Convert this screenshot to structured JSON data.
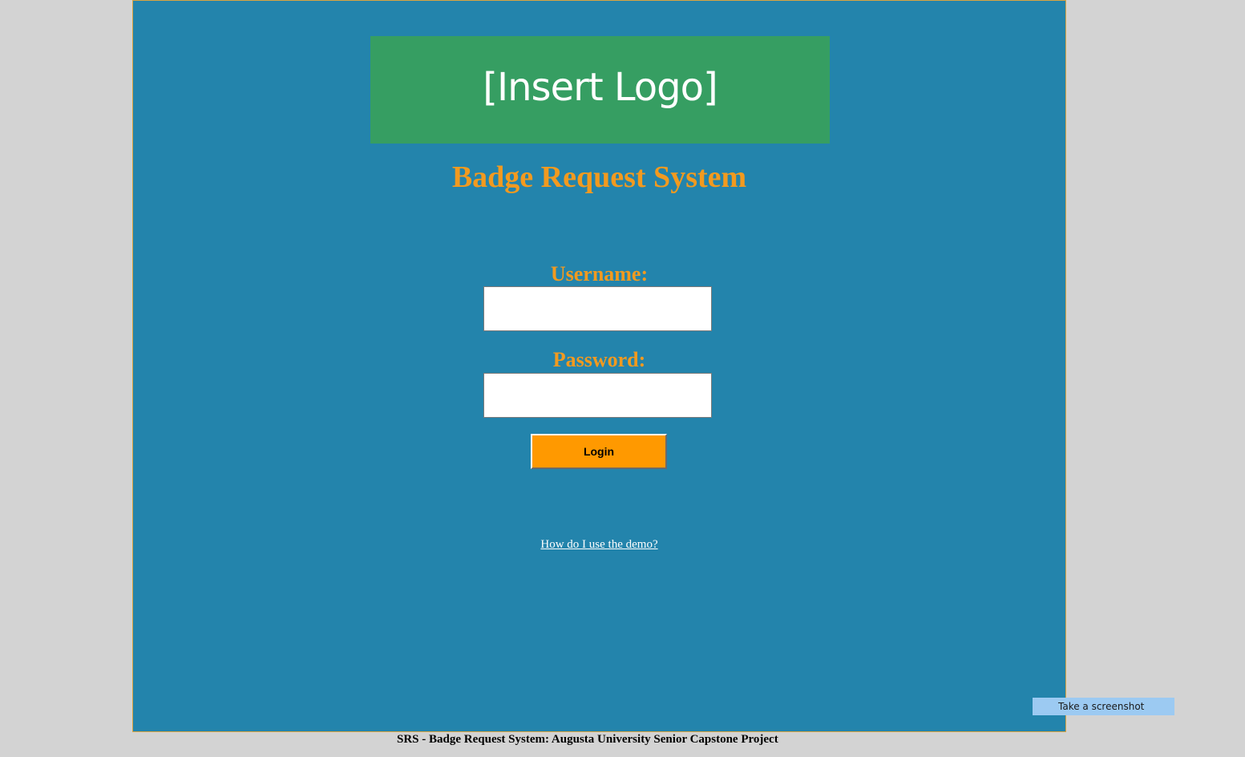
{
  "logo": {
    "text": "[Insert Logo]"
  },
  "page": {
    "title": "Badge Request System"
  },
  "form": {
    "username_label": "Username:",
    "username_value": "",
    "password_label": "Password:",
    "password_value": "",
    "login_label": "Login"
  },
  "links": {
    "demo_help": "How do I use the demo?"
  },
  "footer": {
    "text": "SRS - Badge Request System: Augusta University Senior Capstone Project"
  },
  "overlay": {
    "screenshot_label": "Take a screenshot"
  },
  "colors": {
    "panel_background": "#2384ac",
    "logo_background": "#369e62",
    "accent_orange": "#f29a1f",
    "button_orange": "#ff9900",
    "page_background": "#d3d3d3"
  }
}
